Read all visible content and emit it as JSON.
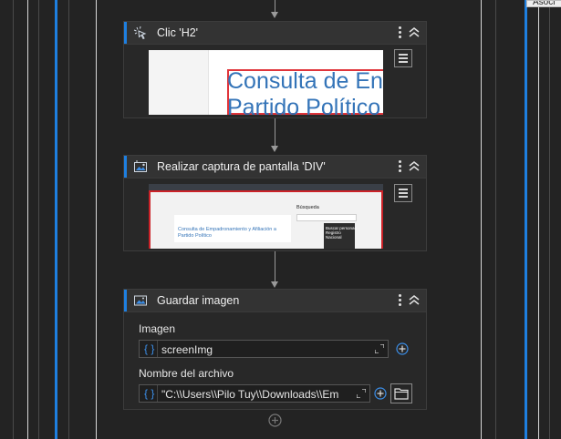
{
  "tooltip": {
    "text": "Asoci"
  },
  "steps": [
    {
      "title": "Clic 'H2'",
      "icon": "cursor-click-icon",
      "preview": {
        "heading_line1": "Consulta de En",
        "heading_line2": "Partido Político"
      }
    },
    {
      "title": "Realizar captura de pantalla 'DIV'",
      "icon": "screenshot-icon",
      "preview": {
        "text_line1": "Consulta de Empadronamiento y Afiliación a",
        "text_line2": "Partido Político",
        "side_heading": "Búsqueda",
        "dark_box_line1": "Buscar personas",
        "dark_box_line2": "Registro",
        "dark_box_line3": "Nacional"
      }
    },
    {
      "title": "Guardar imagen",
      "icon": "image-icon",
      "fields": [
        {
          "label": "Imagen",
          "value": "screenImg"
        },
        {
          "label": "Nombre del archivo",
          "value": "\"C:\\\\Users\\\\Pilo Tuy\\\\Downloads\\\\Em"
        }
      ]
    }
  ],
  "colors": {
    "accent": "#1e7fe0",
    "background": "#232323",
    "card": "#282828",
    "header": "#333333"
  }
}
